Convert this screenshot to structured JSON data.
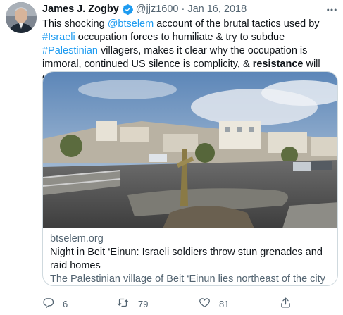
{
  "tweet": {
    "author_name": "James J. Zogby",
    "handle": "@jjz1600",
    "separator": "·",
    "date": "Jan 16, 2018",
    "text_parts": [
      {
        "t": "This shocking ",
        "kind": "plain"
      },
      {
        "t": "@btselem",
        "kind": "link"
      },
      {
        "t": " account of the brutal tactics used by ",
        "kind": "plain"
      },
      {
        "t": "#Israeli",
        "kind": "link"
      },
      {
        "t": " occupation forces to humiliate & try to subdue ",
        "kind": "plain"
      },
      {
        "t": "#Palestinian",
        "kind": "link"
      },
      {
        "t": " villagers, makes it clear why the occupation is immoral, continued US silence is complicity, & ",
        "kind": "plain"
      },
      {
        "t": "resistance",
        "kind": "bold"
      },
      {
        "t": " will continue",
        "kind": "plain"
      }
    ]
  },
  "card": {
    "domain": "btselem.org",
    "title": "Night in Beit ‘Einun: Israeli soldiers throw stun grenades and raid homes",
    "description": "The Palestinian village of Beit ‘Einun lies northeast of the city of Hebron in the West Bank. In 2016, it had a population of some 2,000 ..."
  },
  "actions": {
    "replies": "6",
    "retweets": "79",
    "likes": "81"
  },
  "colors": {
    "link": "#1d9bf0",
    "secondary_text": "#536471",
    "verified": "#1d9bf0",
    "border": "#cfd9de"
  },
  "icons": {
    "verified": "verified-badge-icon",
    "more": "more-options-icon",
    "reply": "reply-icon",
    "retweet": "retweet-icon",
    "like": "heart-icon",
    "share": "share-icon"
  }
}
